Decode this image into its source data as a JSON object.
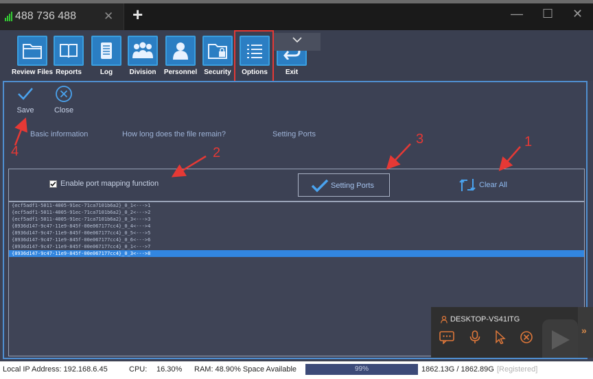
{
  "window": {
    "tab_title": "488 736 488",
    "tab_close": "✕",
    "new_tab": "+",
    "minimize": "—",
    "maximize": "☐",
    "close": "✕"
  },
  "toolbar": {
    "items": [
      {
        "label": "Review Files",
        "icon": "folder-icon"
      },
      {
        "label": "Reports",
        "icon": "book-icon"
      },
      {
        "label": "Log",
        "icon": "notebook-icon"
      },
      {
        "label": "Division",
        "icon": "group-icon"
      },
      {
        "label": "Personnel",
        "icon": "person-icon"
      },
      {
        "label": "Security",
        "icon": "lock-folder-icon"
      },
      {
        "label": "Options",
        "icon": "list-icon"
      },
      {
        "label": "Exit",
        "icon": "exit-icon"
      }
    ],
    "selected": "Options"
  },
  "actions": {
    "save": "Save",
    "close": "Close"
  },
  "subtabs": [
    "Basic information",
    "How long does the file remain?",
    "Setting Ports"
  ],
  "port_options": {
    "enable_mapping_label": "Enable port mapping function",
    "enable_mapping_checked": true,
    "setting_ports_button": "Setting Ports",
    "clear_all_button": "Clear All"
  },
  "port_list": [
    "{ecf5adf1-5011-4005-91ec-71ca7101b6a2}_0_1<--->1",
    "{ecf5adf1-5011-4005-91ec-71ca7101b6a2}_0_2<--->2",
    "{ecf5adf1-5011-4005-91ec-71ca7101b6a2}_0_3<--->3",
    "{8936d147-9c47-11e9-845f-00e067177cc4}_0_4<--->4",
    "{8936d147-9c47-11e9-845f-00e067177cc4}_0_5<--->5",
    "{8936d147-9c47-11e9-845f-00e067177cc4}_0_6<--->6",
    "{8936d147-9c47-11e9-845f-00e067177cc4}_0_1<--->7",
    "{8936d147-9c47-11e9-845f-00e067177cc4}_0_3<--->8"
  ],
  "port_list_selected_index": 7,
  "annotations": [
    "1",
    "2",
    "3",
    "4"
  ],
  "remote_widget": {
    "host": "DESKTOP-VS41ITG",
    "tools": [
      "chat-icon",
      "mic-icon",
      "pointer-icon",
      "close-circle-icon"
    ],
    "expand": "»"
  },
  "statusbar": {
    "ip": "Local IP Address: 192.168.6.45",
    "cpu_label": "CPU:",
    "cpu_value": "16.30%",
    "ram": "RAM: 48.90% Space Available",
    "disk_percent": "99%",
    "disk_fraction": 0.99,
    "space": "1862.13G / 1862.89G",
    "registered": "[Registered]"
  },
  "colors": {
    "accent": "#3286e0",
    "annotation": "#e53935",
    "panel_border": "#4f8fd1"
  }
}
